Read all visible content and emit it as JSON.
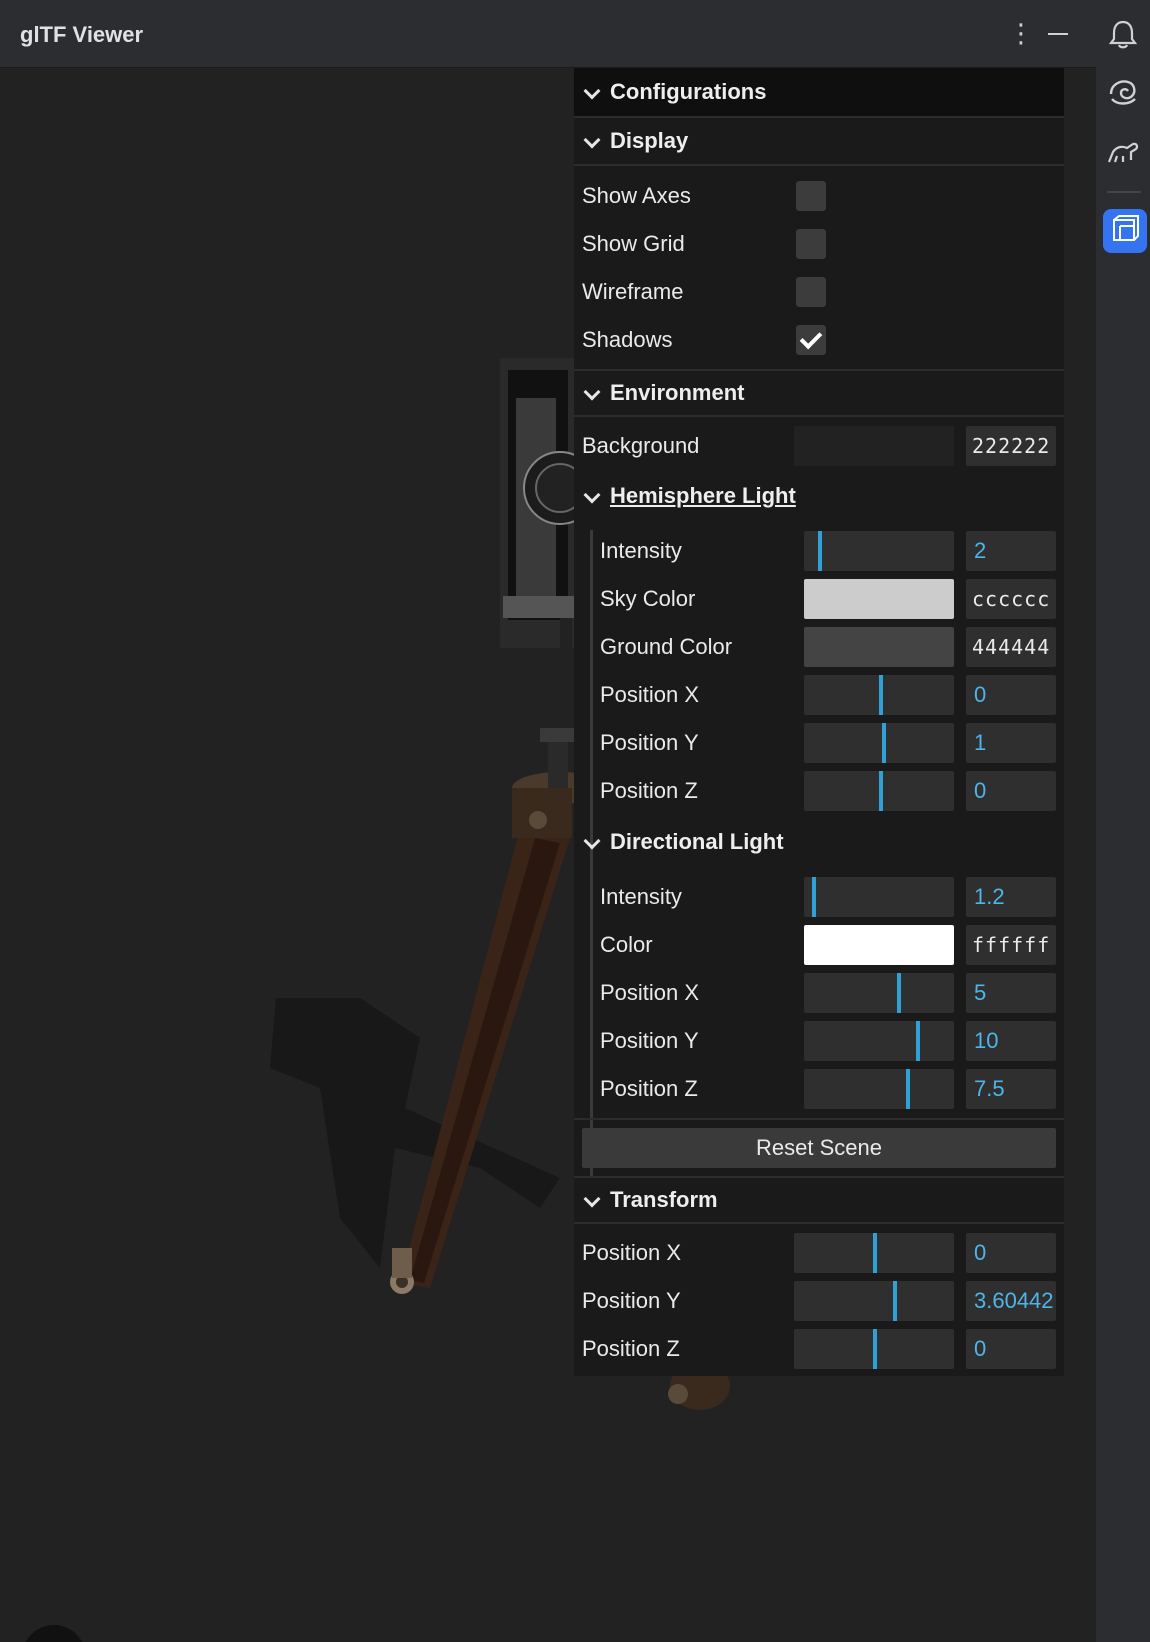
{
  "window": {
    "title": "glTF Viewer"
  },
  "titlebar": {
    "more_icon": "kebab-menu-icon",
    "minimize_icon": "minimize-icon",
    "more_glyph": "⋮"
  },
  "rightbar": {
    "icons": [
      "bell-icon",
      "swirl-icon",
      "dinosaur-icon",
      "gltf-viewer-icon"
    ],
    "active_accent": "#3574f0"
  },
  "panel": {
    "root_label": "Configurations",
    "display": {
      "label": "Display",
      "options": [
        {
          "label": "Show Axes",
          "checked": false
        },
        {
          "label": "Show Grid",
          "checked": false
        },
        {
          "label": "Wireframe",
          "checked": false
        },
        {
          "label": "Shadows",
          "checked": true
        }
      ]
    },
    "environment": {
      "label": "Environment",
      "background_label": "Background",
      "background_value": "222222",
      "background_color": "#222222"
    },
    "hemisphere": {
      "label": "Hemisphere Light",
      "intensity_label": "Intensity",
      "intensity_value": "2",
      "sky_label": "Sky Color",
      "sky_value": "cccccc",
      "sky_color": "#cccccc",
      "ground_label": "Ground Color",
      "ground_value": "444444",
      "ground_color": "#444444",
      "px_label": "Position X",
      "px_value": "0",
      "py_label": "Position Y",
      "py_value": "1",
      "pz_label": "Position Z",
      "pz_value": "0"
    },
    "directional": {
      "label": "Directional Light",
      "intensity_label": "Intensity",
      "intensity_value": "1.2",
      "color_label": "Color",
      "color_value": "ffffff",
      "color_color": "#ffffff",
      "px_label": "Position X",
      "px_value": "5",
      "py_label": "Position Y",
      "py_value": "10",
      "pz_label": "Position Z",
      "pz_value": "7.5"
    },
    "reset_label": "Reset Scene",
    "transform": {
      "label": "Transform",
      "px_label": "Position X",
      "px_value": "0",
      "py_label": "Position Y",
      "py_value": "3.60442",
      "pz_label": "Position Z",
      "pz_value": "0"
    }
  },
  "help": {
    "label": "?"
  },
  "colors": {
    "slider_accent": "#2fa1d6",
    "number_text": "#4fb4e8",
    "panel_bg": "#1a1a1a",
    "viewport_bg": "#222222"
  }
}
